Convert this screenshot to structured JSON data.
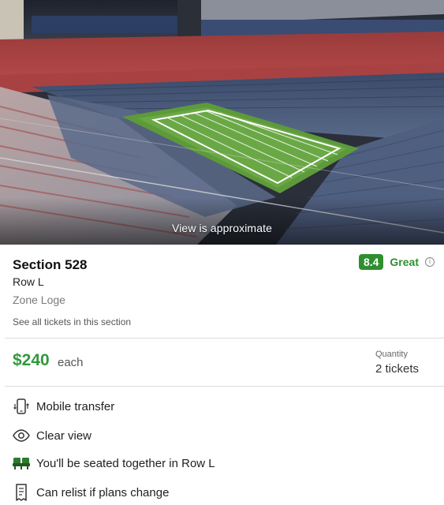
{
  "view": {
    "caption": "View is approximate"
  },
  "section": {
    "title": "Section 528",
    "row": "Row L",
    "zone": "Zone Loge",
    "see_all_link": "See all tickets in this section"
  },
  "rating": {
    "score": "8.4",
    "word": "Great",
    "info_glyph": "i"
  },
  "price": {
    "amount": "$240",
    "unit": "each"
  },
  "quantity": {
    "label": "Quantity",
    "value": "2 tickets"
  },
  "features": [
    {
      "icon": "mobile-transfer-icon",
      "label": "Mobile transfer"
    },
    {
      "icon": "eye-icon",
      "label": "Clear view"
    },
    {
      "icon": "seats-together-icon",
      "label": "You'll be seated together in Row L"
    },
    {
      "icon": "relist-ticket-icon",
      "label": "Can relist if plans change"
    }
  ],
  "colors": {
    "accent_green": "#2f8f2f",
    "price_green": "#2f9a3a"
  }
}
